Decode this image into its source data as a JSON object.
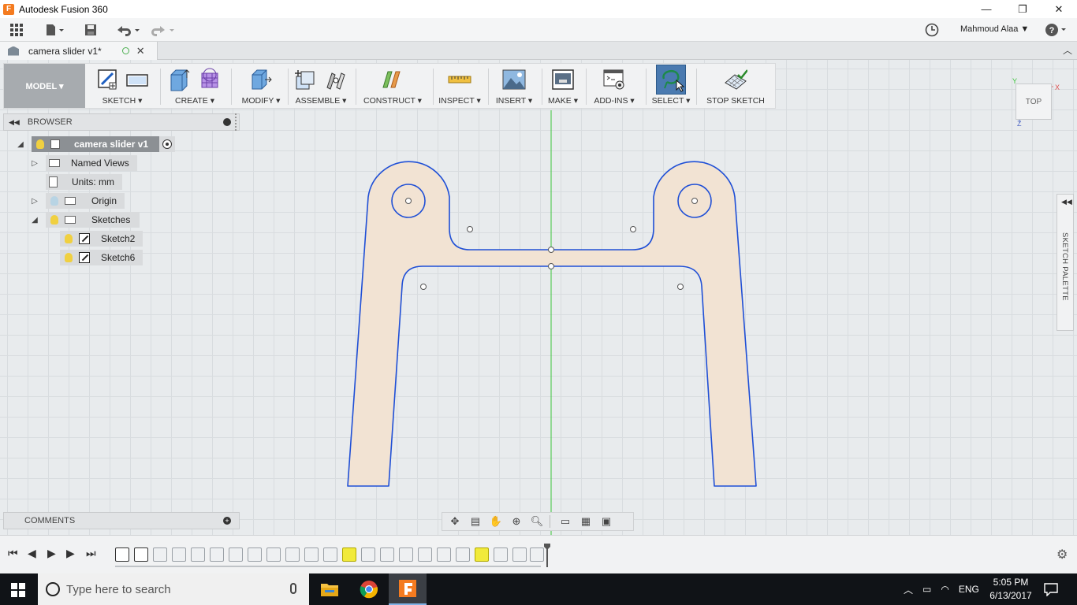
{
  "window": {
    "title": "Autodesk Fusion 360",
    "minimize": "—",
    "maximize": "❐",
    "close": "✕"
  },
  "qat": {
    "user": "Mahmoud Alaa ▼",
    "help": "?"
  },
  "document": {
    "tab_name": "camera slider v1*"
  },
  "toolbar": {
    "workspace": "MODEL ▾",
    "groups": [
      {
        "label": "SKETCH ▾"
      },
      {
        "label": "CREATE ▾"
      },
      {
        "label": "MODIFY ▾"
      },
      {
        "label": "ASSEMBLE ▾"
      },
      {
        "label": "CONSTRUCT ▾"
      },
      {
        "label": "INSPECT ▾"
      },
      {
        "label": "INSERT ▾"
      },
      {
        "label": "MAKE ▾"
      },
      {
        "label": "ADD-INS ▾"
      },
      {
        "label": "SELECT ▾"
      },
      {
        "label": "STOP SKETCH"
      }
    ]
  },
  "browser": {
    "title": "BROWSER",
    "root": "camera slider v1",
    "items": [
      {
        "label": "Named Views"
      },
      {
        "label": "Units: mm"
      },
      {
        "label": "Origin"
      },
      {
        "label": "Sketches"
      },
      {
        "label": "Sketch2"
      },
      {
        "label": "Sketch6"
      }
    ]
  },
  "comments": {
    "title": "COMMENTS"
  },
  "viewcube": {
    "face": "TOP",
    "axis_y": "Y",
    "axis_x": "X",
    "axis_z": "Z"
  },
  "sketch_palette": {
    "label": "SKETCH PALETTE"
  },
  "taskbar": {
    "search_placeholder": "Type here to search",
    "language": "ENG",
    "time": "5:05 PM",
    "date": "6/13/2017"
  },
  "colors": {
    "sketch_line": "#1f4fd6",
    "profile_fill": "#f2e3d3",
    "axis_green": "#3cc43c",
    "highlight": "#f1ea3a"
  }
}
